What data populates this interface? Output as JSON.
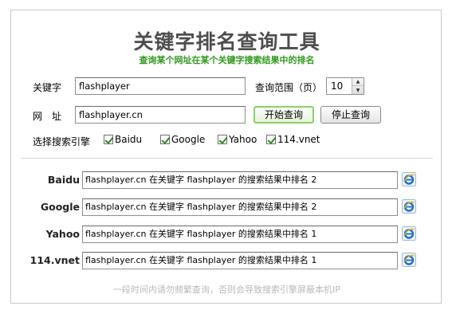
{
  "header": {
    "title": "关键字排名查询工具",
    "subtitle": "查询某个网址在某个关键字搜索结果中的排名"
  },
  "form": {
    "keyword_label": "关键字",
    "keyword_value": "flashplayer",
    "range_label": "查询范围（页）",
    "range_value": "10",
    "url_label": "网　址",
    "url_value": "flashplayer.cn",
    "start_button": "开始查询",
    "stop_button": "停止查询",
    "engines_label": "选择搜索引擎",
    "engines": [
      {
        "label": "Baidu",
        "checked": true
      },
      {
        "label": "Google",
        "checked": true
      },
      {
        "label": "Yahoo",
        "checked": true
      },
      {
        "label": "114.vnet",
        "checked": true
      }
    ]
  },
  "results": [
    {
      "engine": "Baidu",
      "text": "flashplayer.cn 在关键字 flashplayer 的搜索结果中排名 2",
      "icon": "ie-icon"
    },
    {
      "engine": "Google",
      "text": "flashplayer.cn 在关键字 flashplayer 的搜索结果中排名 2",
      "icon": "ie-icon"
    },
    {
      "engine": "Yahoo",
      "text": "flashplayer.cn 在关键字 flashplayer 的搜索结果中排名 1",
      "icon": "ie-icon"
    },
    {
      "engine": "114.vnet",
      "text": "flashplayer.cn 在关键字 flashplayer 的搜索结果中排名 1",
      "icon": "ie-icon"
    }
  ],
  "footer": {
    "note": "一段时间内请勿频繁查询，否则会导致搜索引擎屏蔽本机IP"
  },
  "colors": {
    "subtitle": "#2e9a1b",
    "check": "#2f8a1d",
    "start_button_border": "#8ecf6a",
    "note": "#b8b8b8"
  }
}
